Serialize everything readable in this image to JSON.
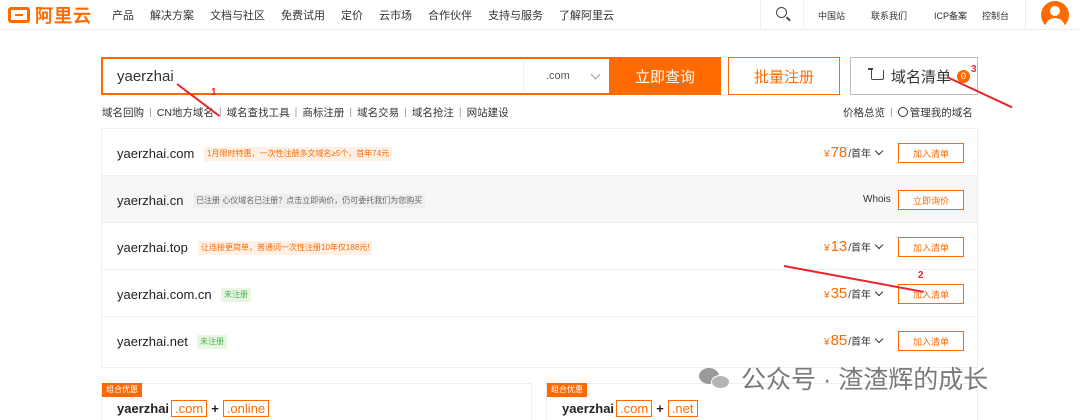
{
  "nav": {
    "logo": "阿里云",
    "menu": [
      "产品",
      "解决方案",
      "文档与社区",
      "免费试用",
      "定价",
      "云市场",
      "合作伙伴",
      "支持与服务",
      "了解阿里云"
    ],
    "region": "中国站",
    "contact": "联系我们",
    "icp": "ICP备案",
    "console": "控制台"
  },
  "search": {
    "value": "yaerzhai",
    "tld": ".com",
    "button": "立即查询",
    "bulk": "批量注册",
    "cart": "域名清单",
    "cart_count": "0"
  },
  "sublinks": [
    "域名回购",
    "CN地方域名",
    "域名查找工具",
    "商标注册",
    "域名交易",
    "域名抢注",
    "网站建设"
  ],
  "right_links": {
    "price": "价格总览",
    "manage": "管理我的域名"
  },
  "results": [
    {
      "domain": "yaerzhai.com",
      "tag": "1月限时特惠，一次性注册多文域名≥5个，首年74元",
      "price_symbol": "¥",
      "price": "78",
      "unit": "/首年",
      "action": "加入清单"
    },
    {
      "domain": "yaerzhai.cn",
      "tag": "已注册 心仪域名已注册？点击立即询价，仍可委托我们为您购买",
      "whois": "Whois",
      "action": "立即询价"
    },
    {
      "domain": "yaerzhai.top",
      "tag": "让连接更简单，普通词一次性注册10年仅188元!",
      "price_symbol": "¥",
      "price": "13",
      "unit": "/首年",
      "action": "加入清单"
    },
    {
      "domain": "yaerzhai.com.cn",
      "tag": "未注册",
      "price_symbol": "¥",
      "price": "35",
      "unit": "/首年",
      "action": "加入清单"
    },
    {
      "domain": "yaerzhai.net",
      "tag": "未注册",
      "price_symbol": "¥",
      "price": "85",
      "unit": "/首年",
      "action": "加入清单"
    }
  ],
  "bundles": [
    {
      "badge": "组合优惠",
      "name": "yaerzhai",
      "tld1": ".com",
      "plus": "+",
      "tld2": ".online"
    },
    {
      "badge": "组合优惠",
      "name": "yaerzhai",
      "tld1": ".com",
      "plus": "+",
      "tld2": ".net"
    }
  ],
  "annotations": {
    "n1": "1",
    "n2": "2",
    "n3": "3",
    "color": "#e8252a"
  },
  "watermark": "公众号 · 渣渣辉的成长",
  "colors": {
    "accent": "#ff6a00",
    "annotation": "#e8252a"
  }
}
